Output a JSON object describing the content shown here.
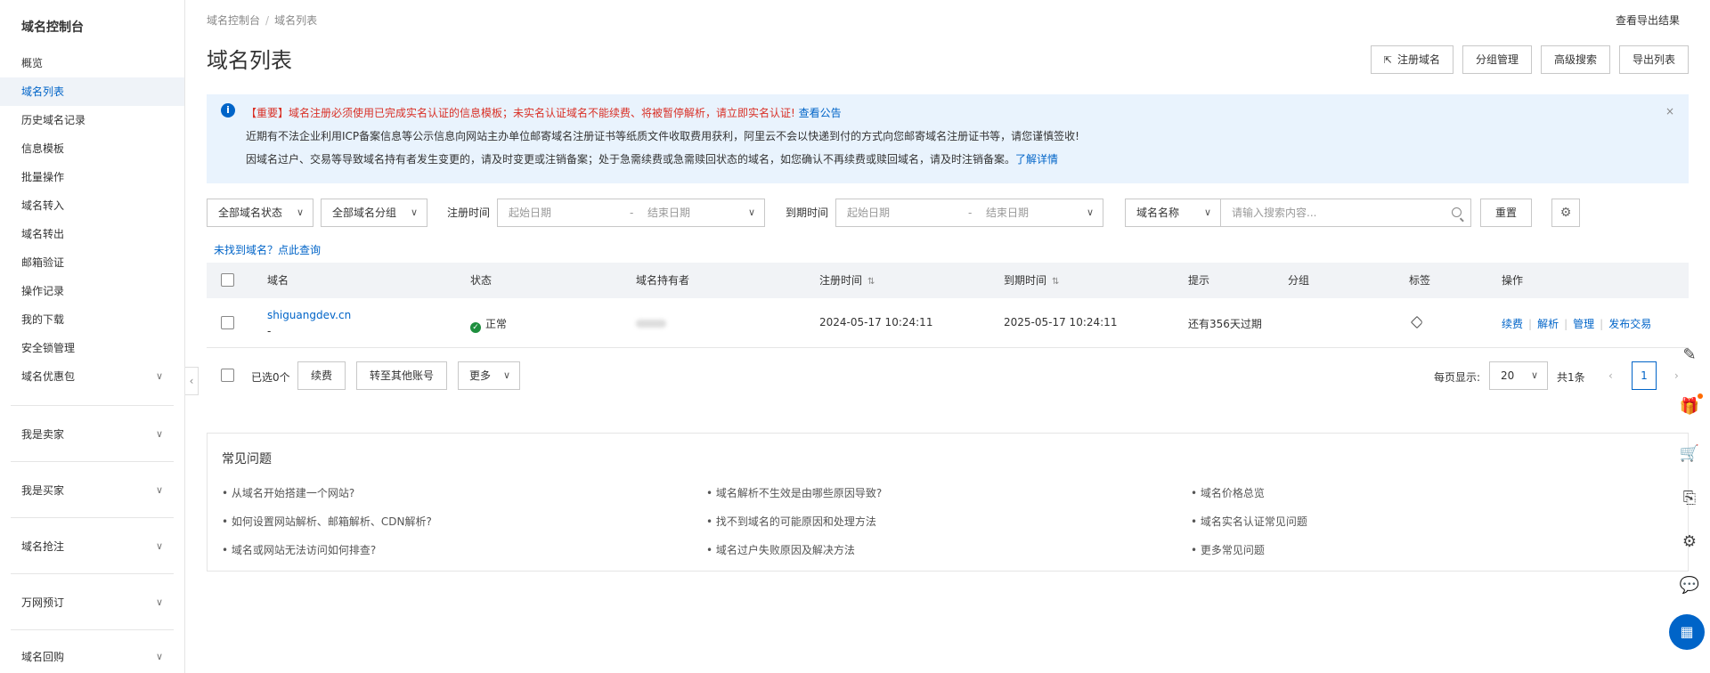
{
  "sidebar": {
    "title": "域名控制台",
    "items": [
      {
        "label": "概览"
      },
      {
        "label": "域名列表"
      },
      {
        "label": "历史域名记录"
      },
      {
        "label": "信息模板"
      },
      {
        "label": "批量操作"
      },
      {
        "label": "域名转入"
      },
      {
        "label": "域名转出"
      },
      {
        "label": "邮箱验证"
      },
      {
        "label": "操作记录"
      },
      {
        "label": "我的下载"
      },
      {
        "label": "安全锁管理"
      },
      {
        "label": "域名优惠包"
      }
    ],
    "groups": [
      {
        "label": "我是卖家"
      },
      {
        "label": "我是买家"
      },
      {
        "label": "域名抢注"
      },
      {
        "label": "万网预订"
      },
      {
        "label": "域名回购"
      }
    ],
    "collapse_glyph": "‹"
  },
  "header": {
    "breadcrumb_root": "域名控制台",
    "breadcrumb_sep": "/",
    "breadcrumb_current": "域名列表",
    "export_result_link": "查看导出结果",
    "page_title": "域名列表",
    "actions": {
      "register": "注册域名",
      "group_manage": "分组管理",
      "advanced_search": "高级搜索",
      "export_list": "导出列表"
    }
  },
  "notice": {
    "line1": "【重要】域名注册必须使用已完成实名认证的信息模板；未实名认证域名不能续费、将被暂停解析，请立即实名认证!",
    "line1_link": "查看公告",
    "line2": "近期有不法企业利用ICP备案信息等公示信息向网站主办单位邮寄域名注册证书等纸质文件收取费用获利，阿里云不会以快递到付的方式向您邮寄域名注册证书等，请您谨慎签收!",
    "line3": "因域名过户、交易等导致域名持有者发生变更的，请及时变更或注销备案；处于急需续费或急需赎回状态的域名，如您确认不再续费或赎回域名，请及时注销备案。",
    "line3_link": "了解详情",
    "close": "×",
    "icon_glyph": "i"
  },
  "filters": {
    "status_select": "全部域名状态",
    "group_select": "全部域名分组",
    "reg_time_label": "注册时间",
    "exp_time_label": "到期时间",
    "start_date": "起始日期",
    "range_sep": "-",
    "end_date": "结束日期",
    "search_field_select": "域名名称",
    "search_placeholder": "请输入搜索内容...",
    "reset": "重置",
    "settings_glyph": "⚙"
  },
  "not_found_link": "未找到域名？点此查询",
  "table": {
    "headers": {
      "domain": "域名",
      "status": "状态",
      "holder": "域名持有者",
      "reg_time": "注册时间",
      "exp_time": "到期时间",
      "hint": "提示",
      "group": "分组",
      "tag": "标签",
      "ops": "操作"
    },
    "sort_glyph": "⇅",
    "rows": [
      {
        "domain": "shiguangdev.cn",
        "sub": "-",
        "status": "正常",
        "reg_time": "2024-05-17 10:24:11",
        "exp_time": "2025-05-17 10:24:11",
        "hint": "还有356天过期",
        "ops": {
          "renew": "续费",
          "dns": "解析",
          "manage": "管理",
          "trade": "发布交易"
        }
      }
    ]
  },
  "bulk": {
    "selected": "已选0个",
    "renew": "续费",
    "transfer": "转至其他账号",
    "more": "更多"
  },
  "pagination": {
    "per_page_label": "每页显示:",
    "per_page": "20",
    "total": "共1条",
    "page": "1",
    "prev": "‹",
    "next": "›"
  },
  "faq": {
    "title": "常见问题",
    "items": [
      "从域名开始搭建一个网站?",
      "如何设置网站解析、邮箱解析、CDN解析?",
      "域名或网站无法访问如何排查?",
      "域名解析不生效是由哪些原因导致?",
      "找不到域名的可能原因和处理方法",
      "域名过户失败原因及解决方法",
      "域名价格总览",
      "域名实名认证常见问题",
      "更多常见问题"
    ]
  },
  "float_bar": {
    "edit": "✎",
    "gift": "🎁",
    "cart": "🛒",
    "record": "⎘",
    "settings": "⚙",
    "chat": "💬",
    "apps": "▦"
  },
  "colors": {
    "primary": "#0064c8",
    "danger": "#d93026",
    "success": "#1e8e3e",
    "notice_bg": "#e9f3fd",
    "table_head_bg": "#f1f3f6"
  }
}
